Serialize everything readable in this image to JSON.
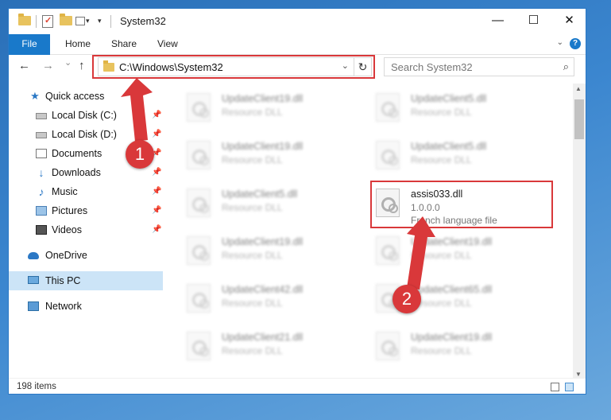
{
  "window": {
    "title": "System32",
    "minimize_glyph": "—",
    "maximize_glyph": "☐",
    "close_glyph": "✕"
  },
  "ribbon": {
    "tabs": [
      "File",
      "Home",
      "Share",
      "View"
    ],
    "help_glyph": "?"
  },
  "navbar": {
    "back_glyph": "←",
    "forward_glyph": "→",
    "recent_glyph": "⌄",
    "up_glyph": "↑",
    "address": "C:\\Windows\\System32",
    "refresh_glyph": "↻",
    "search_placeholder": "Search System32"
  },
  "sidebar": {
    "items": [
      {
        "label": "Quick access",
        "icon": "star-icon",
        "pinned": false
      },
      {
        "label": "Local Disk (C:)",
        "icon": "disk-icon",
        "pinned": true
      },
      {
        "label": "Local Disk (D:)",
        "icon": "disk-icon",
        "pinned": true
      },
      {
        "label": "Documents",
        "icon": "documents-icon",
        "pinned": true
      },
      {
        "label": "Downloads",
        "icon": "downloads-icon",
        "pinned": true
      },
      {
        "label": "Music",
        "icon": "music-icon",
        "pinned": true
      },
      {
        "label": "Pictures",
        "icon": "pictures-icon",
        "pinned": true
      },
      {
        "label": "Videos",
        "icon": "videos-icon",
        "pinned": true
      },
      {
        "label": "OneDrive",
        "icon": "onedrive-icon",
        "pinned": false
      },
      {
        "label": "This PC",
        "icon": "this-pc-icon",
        "pinned": false,
        "selected": true
      },
      {
        "label": "Network",
        "icon": "network-icon",
        "pinned": false
      }
    ]
  },
  "files": {
    "left_column": [
      {
        "name": "UpdateClient19.dll",
        "type": "Resource DLL"
      },
      {
        "name": "UpdateClient19.dll",
        "type": "Resource DLL"
      },
      {
        "name": "UpdateClient5.dll",
        "type": "Resource DLL"
      },
      {
        "name": "UpdateClient19.dll",
        "type": "Resource DLL"
      },
      {
        "name": "UpdateClient42.dll",
        "type": "Resource DLL"
      },
      {
        "name": "UpdateClient21.dll",
        "type": "Resource DLL"
      }
    ],
    "right_column": [
      {
        "name": "UpdateClient5.dll",
        "type": "Resource DLL"
      },
      {
        "name": "UpdateClient5.dll",
        "type": "Resource DLL"
      },
      {
        "name": "assis033.dll",
        "version": "1.0.0.0",
        "type": "French language file",
        "highlighted": true
      },
      {
        "name": "UpdateClient19.dll",
        "type": "Resource DLL"
      },
      {
        "name": "UpdateClient65.dll",
        "type": "Resource DLL"
      },
      {
        "name": "UpdateClient19.dll",
        "type": "Resource DLL"
      }
    ]
  },
  "status": {
    "item_count": "198 items"
  },
  "annotations": {
    "step1": "1",
    "step2": "2",
    "color": "#d9383a"
  },
  "colors": {
    "accent": "#1979ca",
    "selection": "#cce4f7",
    "highlight": "#d9383a"
  }
}
